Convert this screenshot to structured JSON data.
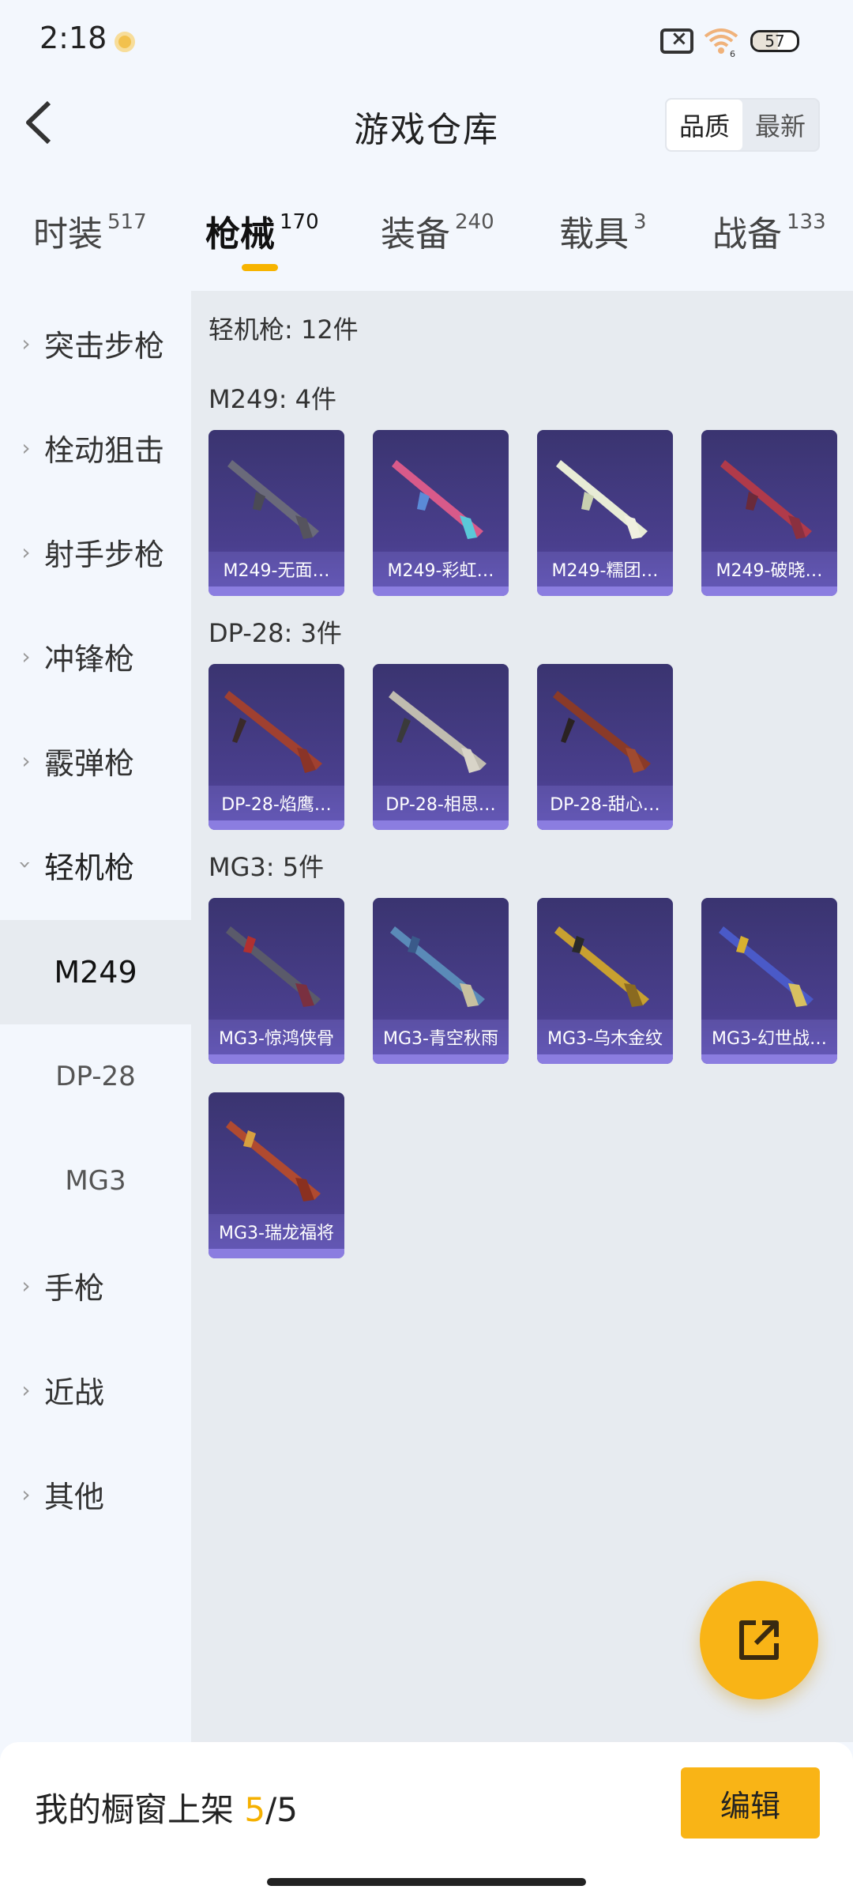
{
  "status_bar": {
    "time": "2:18",
    "battery": "57",
    "wifi_sub": "6"
  },
  "header": {
    "title": "游戏仓库",
    "sort_options": [
      "品质",
      "最新"
    ],
    "sort_active": "品质"
  },
  "tabs": [
    {
      "label": "时装",
      "count": "517"
    },
    {
      "label": "枪械",
      "count": "170",
      "active": true
    },
    {
      "label": "装备",
      "count": "240"
    },
    {
      "label": "载具",
      "count": "3"
    },
    {
      "label": "战备",
      "count": "133"
    }
  ],
  "sidebar": {
    "categories": [
      "突击步枪",
      "栓动狙击",
      "射手步枪",
      "冲锋枪",
      "霰弹枪",
      "轻机枪"
    ],
    "expanded": "轻机枪",
    "subitems": [
      "M249",
      "DP-28",
      "MG3"
    ],
    "active_sub": "M249",
    "categories_after": [
      "手枪",
      "近战",
      "其他"
    ]
  },
  "content": {
    "summary": "轻机枪: 12件",
    "groups": [
      {
        "title": "M249: 4件",
        "items": [
          "M249-无面…",
          "M249-彩虹…",
          "M249-糯团…",
          "M249-破晓…"
        ]
      },
      {
        "title": "DP-28: 3件",
        "items": [
          "DP-28-焰鹰…",
          "DP-28-相思…",
          "DP-28-甜心…"
        ]
      },
      {
        "title": "MG3: 5件",
        "items": [
          "MG3-惊鸿侠骨",
          "MG3-青空秋雨",
          "MG3-乌木金纹",
          "MG3-幻世战…",
          "MG3-瑞龙福将"
        ]
      }
    ]
  },
  "bottom": {
    "showcase_label": "我的橱窗上架",
    "current": "5",
    "total": "/5",
    "edit_label": "编辑"
  },
  "colors": {
    "accent": "#f9b416",
    "card_bg": "#3a3470",
    "content_bg": "#e7ebf0"
  },
  "icons": {
    "back": "chevron-left-icon",
    "fab": "share-external-icon",
    "sidebar": "chevron-right-icon"
  }
}
